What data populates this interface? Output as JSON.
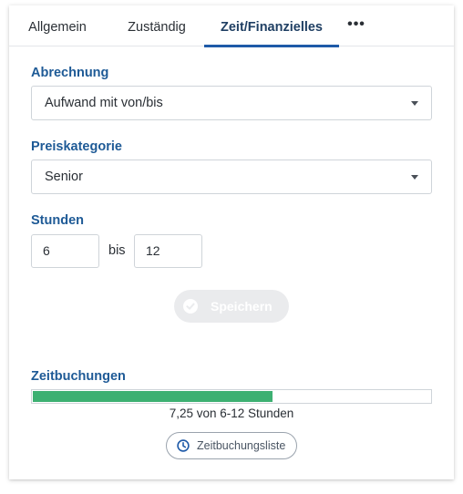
{
  "tabs": [
    {
      "label": "Allgemein",
      "active": false
    },
    {
      "label": "Zuständig",
      "active": false
    },
    {
      "label": "Zeit/Finanzielles",
      "active": true
    },
    {
      "label": "•••",
      "active": false
    }
  ],
  "abrechnung": {
    "label": "Abrechnung",
    "value": "Aufwand mit von/bis"
  },
  "preiskategorie": {
    "label": "Preiskategorie",
    "value": "Senior"
  },
  "stunden": {
    "label": "Stunden",
    "from": "6",
    "to": "12",
    "separator": "bis"
  },
  "save_button": {
    "label": "Speichern",
    "enabled": false
  },
  "zeitbuchungen": {
    "label": "Zeitbuchungen",
    "progress_fraction": 0.604,
    "progress_text": "7,25 von 6-12 Stunden",
    "list_button_label": "Zeitbuchungsliste"
  },
  "colors": {
    "accent": "#1e5aa8",
    "label": "#1e5a96",
    "progress": "#3db072"
  },
  "icons": {
    "tab_more": "more-dots-icon",
    "select_caret": "caret-down-icon",
    "save": "check-circle-icon",
    "list": "clock-icon"
  }
}
